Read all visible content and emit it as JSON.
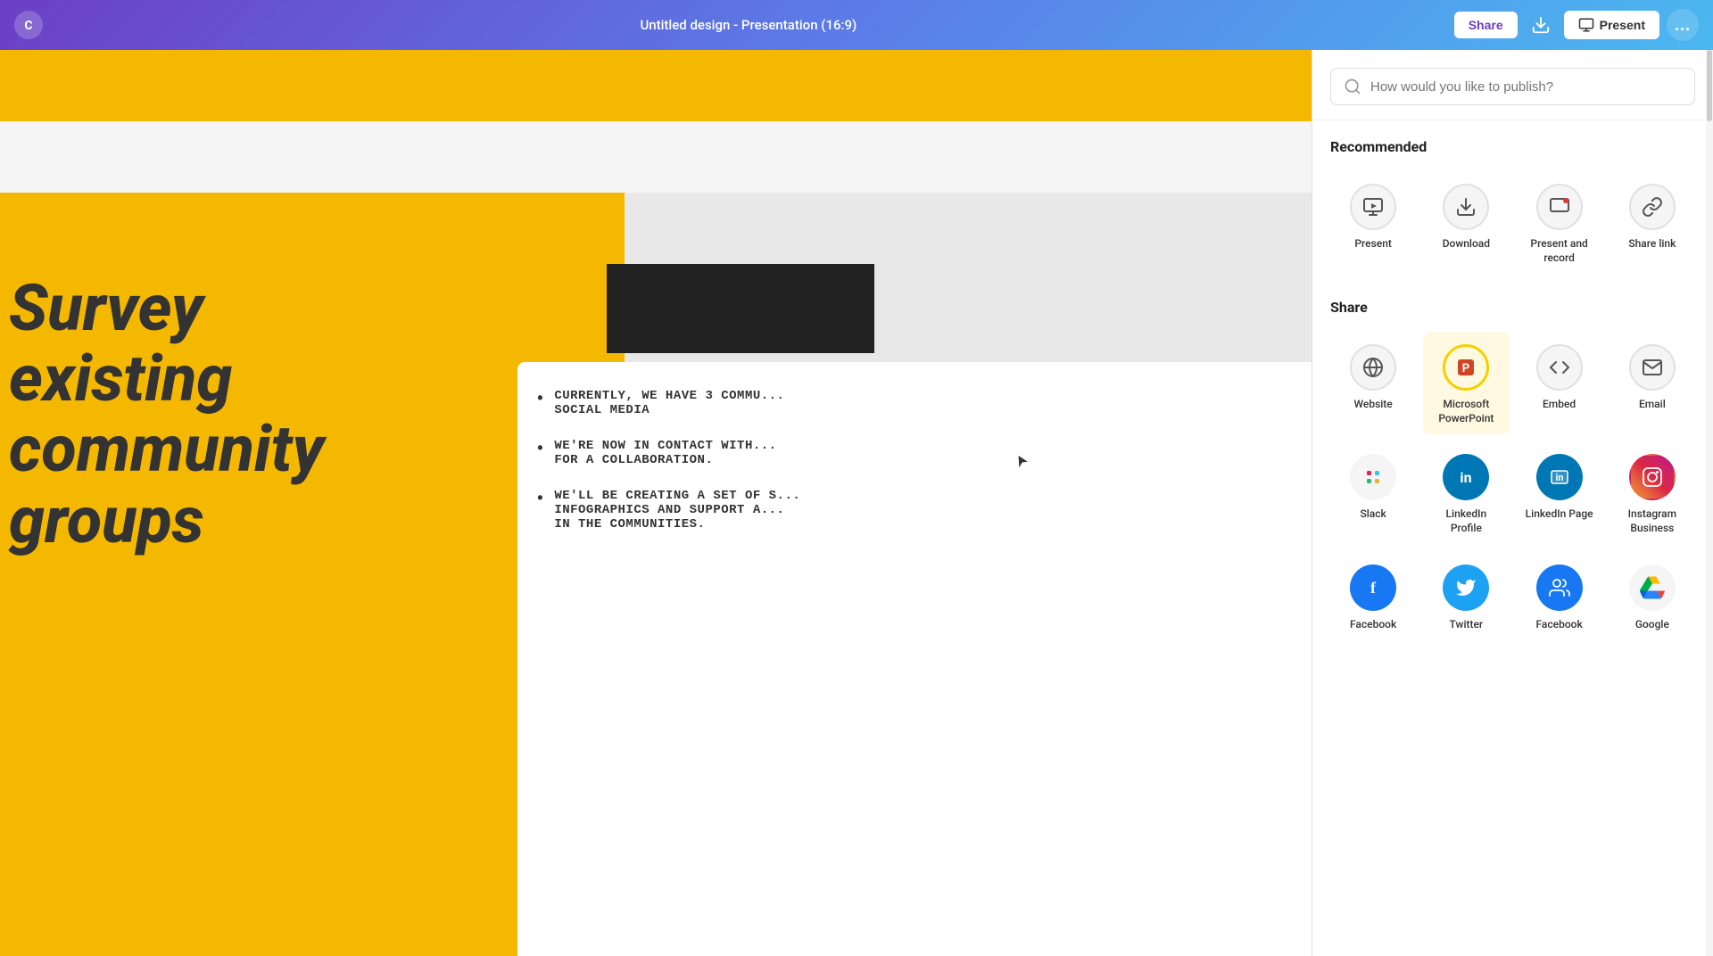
{
  "header": {
    "title": "Untitled design - Presentation (16:9)",
    "share_label": "Share",
    "present_label": "Present",
    "more_label": "..."
  },
  "search": {
    "placeholder": "How would you like to publish?"
  },
  "panel": {
    "recommended_label": "Recommended",
    "share_label": "Share",
    "items_recommended": [
      {
        "id": "present",
        "label": "Present"
      },
      {
        "id": "download",
        "label": "Download"
      },
      {
        "id": "present-record",
        "label": "Present and record"
      },
      {
        "id": "share-link",
        "label": "Share link"
      }
    ],
    "items_share": [
      {
        "id": "website",
        "label": "Website"
      },
      {
        "id": "microsoft-powerpoint",
        "label": "Microsoft PowerPoint",
        "highlighted": true
      },
      {
        "id": "embed",
        "label": "Embed"
      },
      {
        "id": "email",
        "label": "Email"
      },
      {
        "id": "slack",
        "label": "Slack"
      },
      {
        "id": "linkedin-profile",
        "label": "LinkedIn Profile"
      },
      {
        "id": "linkedin-page",
        "label": "LinkedIn Page"
      },
      {
        "id": "instagram-business",
        "label": "Instagram Business"
      },
      {
        "id": "facebook",
        "label": "Facebook"
      },
      {
        "id": "twitter",
        "label": "Twitter"
      },
      {
        "id": "facebook-group",
        "label": "Facebook"
      },
      {
        "id": "google-drive",
        "label": "Google"
      }
    ]
  },
  "slide": {
    "title_line1": "Survey",
    "title_line2": "existing",
    "title_line3": "community",
    "title_line4": "groups",
    "bullet1": "CURRENTLY, WE HAVE 3 COMMU... SOCIAL MEDIA",
    "bullet2": "WE'RE NOW IN CONTACT WITH... FOR A COLLABORATION.",
    "bullet3": "WE'LL BE CREATING A SET OF S... INFOGRAPHICS AND SUPPORT A... IN THE COMMUNITIES."
  }
}
